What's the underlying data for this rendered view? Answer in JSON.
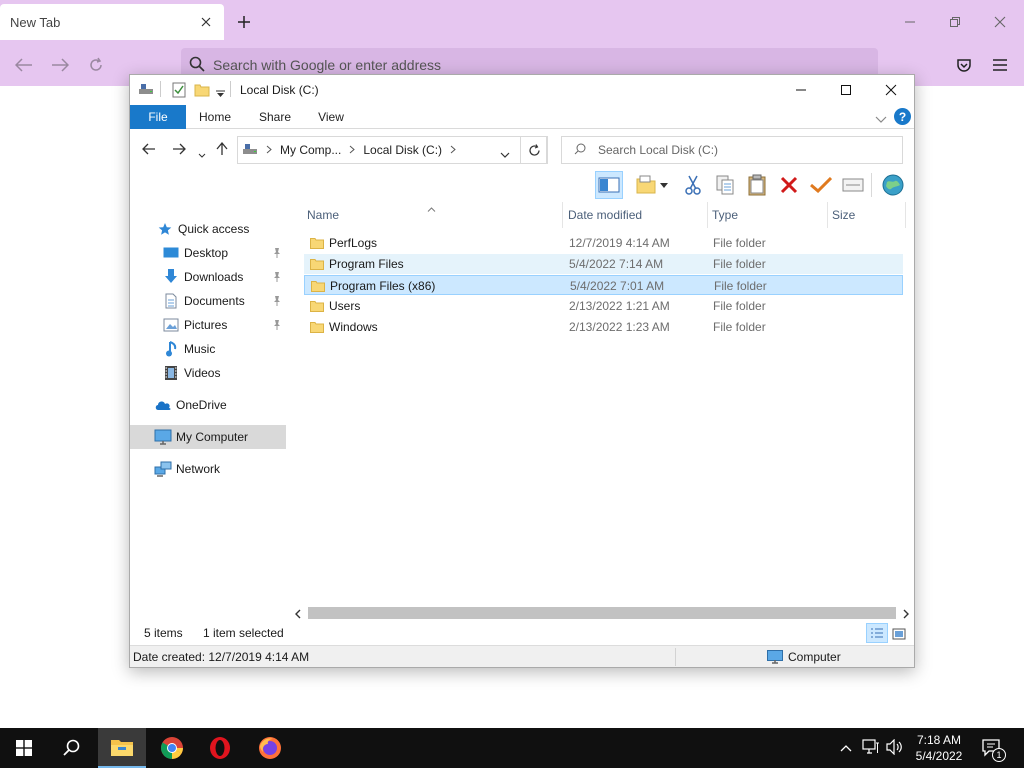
{
  "browser": {
    "tab_title": "New Tab",
    "url_placeholder": "Search with Google or enter address"
  },
  "explorer": {
    "title": "Local Disk (C:)",
    "ribbon_tabs": [
      "File",
      "Home",
      "Share",
      "View"
    ],
    "breadcrumb": [
      "My Comp...",
      "Local Disk (C:)"
    ],
    "search_placeholder": "Search Local Disk (C:)",
    "columns": [
      "Name",
      "Date modified",
      "Type",
      "Size"
    ],
    "files": [
      {
        "name": "PerfLogs",
        "date": "12/7/2019 4:14 AM",
        "type": "File folder",
        "state": "normal"
      },
      {
        "name": "Program Files",
        "date": "5/4/2022 7:14 AM",
        "type": "File folder",
        "state": "hover"
      },
      {
        "name": "Program Files (x86)",
        "date": "5/4/2022 7:01 AM",
        "type": "File folder",
        "state": "selected"
      },
      {
        "name": "Users",
        "date": "2/13/2022 1:21 AM",
        "type": "File folder",
        "state": "normal"
      },
      {
        "name": "Windows",
        "date": "2/13/2022 1:23 AM",
        "type": "File folder",
        "state": "normal"
      }
    ],
    "nav": {
      "quick_access": "Quick access",
      "desktop": "Desktop",
      "downloads": "Downloads",
      "documents": "Documents",
      "pictures": "Pictures",
      "music": "Music",
      "videos": "Videos",
      "onedrive": "OneDrive",
      "my_computer": "My Computer",
      "network": "Network"
    },
    "status": {
      "item_count": "5 items",
      "selection": "1 item selected",
      "date_created": "Date created: 12/7/2019 4:14 AM",
      "location": "Computer"
    }
  },
  "taskbar": {
    "time": "7:18 AM",
    "date": "5/4/2022",
    "notification_count": "1"
  },
  "colors": {
    "browser_chrome": "#e6c6f0",
    "accent": "#1979ca",
    "selection": "#cce8ff",
    "taskbar": "#101010"
  }
}
